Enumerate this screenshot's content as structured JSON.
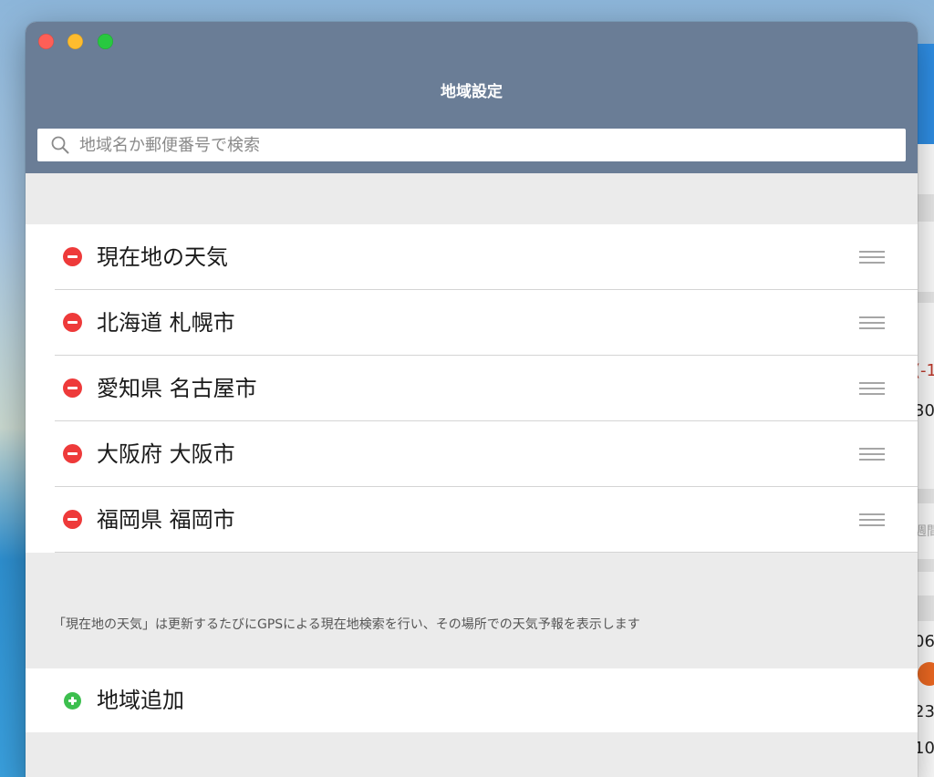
{
  "window": {
    "title": "地域設定",
    "controls": {
      "close": "close",
      "minimize": "minimize",
      "zoom": "zoom"
    }
  },
  "search": {
    "placeholder": "地域名か郵便番号で検索",
    "value": "",
    "icon": "search-icon"
  },
  "locations": {
    "items": [
      {
        "label": "現在地の天気",
        "remove_icon": "minus-circle-icon",
        "handle_icon": "drag-handle-icon"
      },
      {
        "label": "北海道 札幌市",
        "remove_icon": "minus-circle-icon",
        "handle_icon": "drag-handle-icon"
      },
      {
        "label": "愛知県 名古屋市",
        "remove_icon": "minus-circle-icon",
        "handle_icon": "drag-handle-icon"
      },
      {
        "label": "大阪府 大阪市",
        "remove_icon": "minus-circle-icon",
        "handle_icon": "drag-handle-icon"
      },
      {
        "label": "福岡県 福岡市",
        "remove_icon": "minus-circle-icon",
        "handle_icon": "drag-handle-icon"
      }
    ]
  },
  "note": "「現在地の天気」は更新するたびにGPSによる現在地検索を行い、その場所での天気予報を表示します",
  "add_location": {
    "label": "地域追加",
    "icon": "plus-circle-icon"
  },
  "background_app": {
    "fragments": [
      "(-1",
      "30",
      "週間",
      "06",
      "23",
      "10"
    ]
  },
  "colors": {
    "titlebar": "#6a7d96",
    "remove": "#ee3a3a",
    "add": "#3cbf4e",
    "list_background": "#ffffff",
    "group_background": "#ebebeb"
  }
}
